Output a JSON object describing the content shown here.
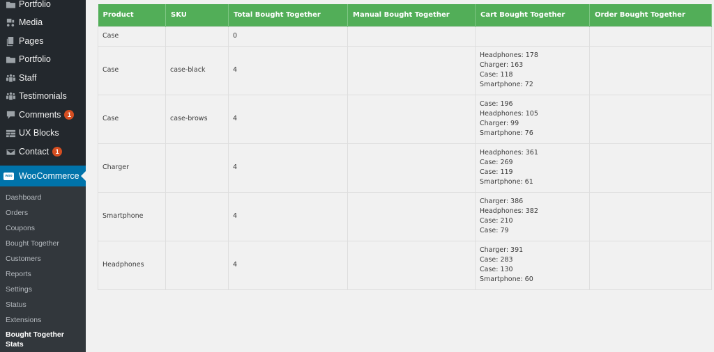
{
  "sidebar": {
    "items": [
      {
        "label": "Portfolio",
        "icon": "folder-icon"
      },
      {
        "label": "Media",
        "icon": "media-icon"
      },
      {
        "label": "Pages",
        "icon": "pages-icon"
      },
      {
        "label": "Portfolio",
        "icon": "folder-icon"
      },
      {
        "label": "Staff",
        "icon": "people-icon"
      },
      {
        "label": "Testimonials",
        "icon": "people-icon"
      },
      {
        "label": "Comments",
        "icon": "comment-icon",
        "badge": "1"
      },
      {
        "label": "UX Blocks",
        "icon": "blocks-icon"
      },
      {
        "label": "Contact",
        "icon": "mail-icon",
        "badge": "1"
      }
    ],
    "active": {
      "label": "WooCommerce",
      "logo_text": "woo"
    },
    "submenu": [
      {
        "label": "Dashboard"
      },
      {
        "label": "Orders"
      },
      {
        "label": "Coupons"
      },
      {
        "label": "Bought Together"
      },
      {
        "label": "Customers"
      },
      {
        "label": "Reports"
      },
      {
        "label": "Settings"
      },
      {
        "label": "Status"
      },
      {
        "label": "Extensions"
      },
      {
        "label": "Bought Together Stats",
        "current": true
      }
    ]
  },
  "table": {
    "headers": [
      "Product",
      "SKU",
      "Total Bought Together",
      "Manual Bought Together",
      "Cart Bought Together",
      "Order Bought Together"
    ],
    "rows": [
      {
        "product": "Case",
        "sku": "",
        "total": "0",
        "manual": "",
        "cart": [],
        "order": ""
      },
      {
        "product": "Case",
        "sku": "case-black",
        "total": "4",
        "manual": "",
        "cart": [
          "Headphones: 178",
          "Charger: 163",
          "Case: 118",
          "Smartphone: 72"
        ],
        "order": ""
      },
      {
        "product": "Case",
        "sku": "case-brows",
        "total": "4",
        "manual": "",
        "cart": [
          "Case: 196",
          "Headphones: 105",
          "Charger: 99",
          "Smartphone: 76"
        ],
        "order": ""
      },
      {
        "product": "Charger",
        "sku": "",
        "total": "4",
        "manual": "",
        "cart": [
          "Headphones: 361",
          "Case: 269",
          "Case: 119",
          "Smartphone: 61"
        ],
        "order": ""
      },
      {
        "product": "Smartphone",
        "sku": "",
        "total": "4",
        "manual": "",
        "cart": [
          "Charger: 386",
          "Headphones: 382",
          "Case: 210",
          "Case: 79"
        ],
        "order": ""
      },
      {
        "product": "Headphones",
        "sku": "",
        "total": "4",
        "manual": "",
        "cart": [
          "Charger: 391",
          "Case: 283",
          "Case: 130",
          "Smartphone: 60"
        ],
        "order": ""
      }
    ]
  },
  "colors": {
    "header_green": "#52ae58",
    "sidebar_bg": "#23282d",
    "submenu_bg": "#32373c",
    "active_blue": "#0073aa",
    "badge_red": "#d54e21"
  }
}
